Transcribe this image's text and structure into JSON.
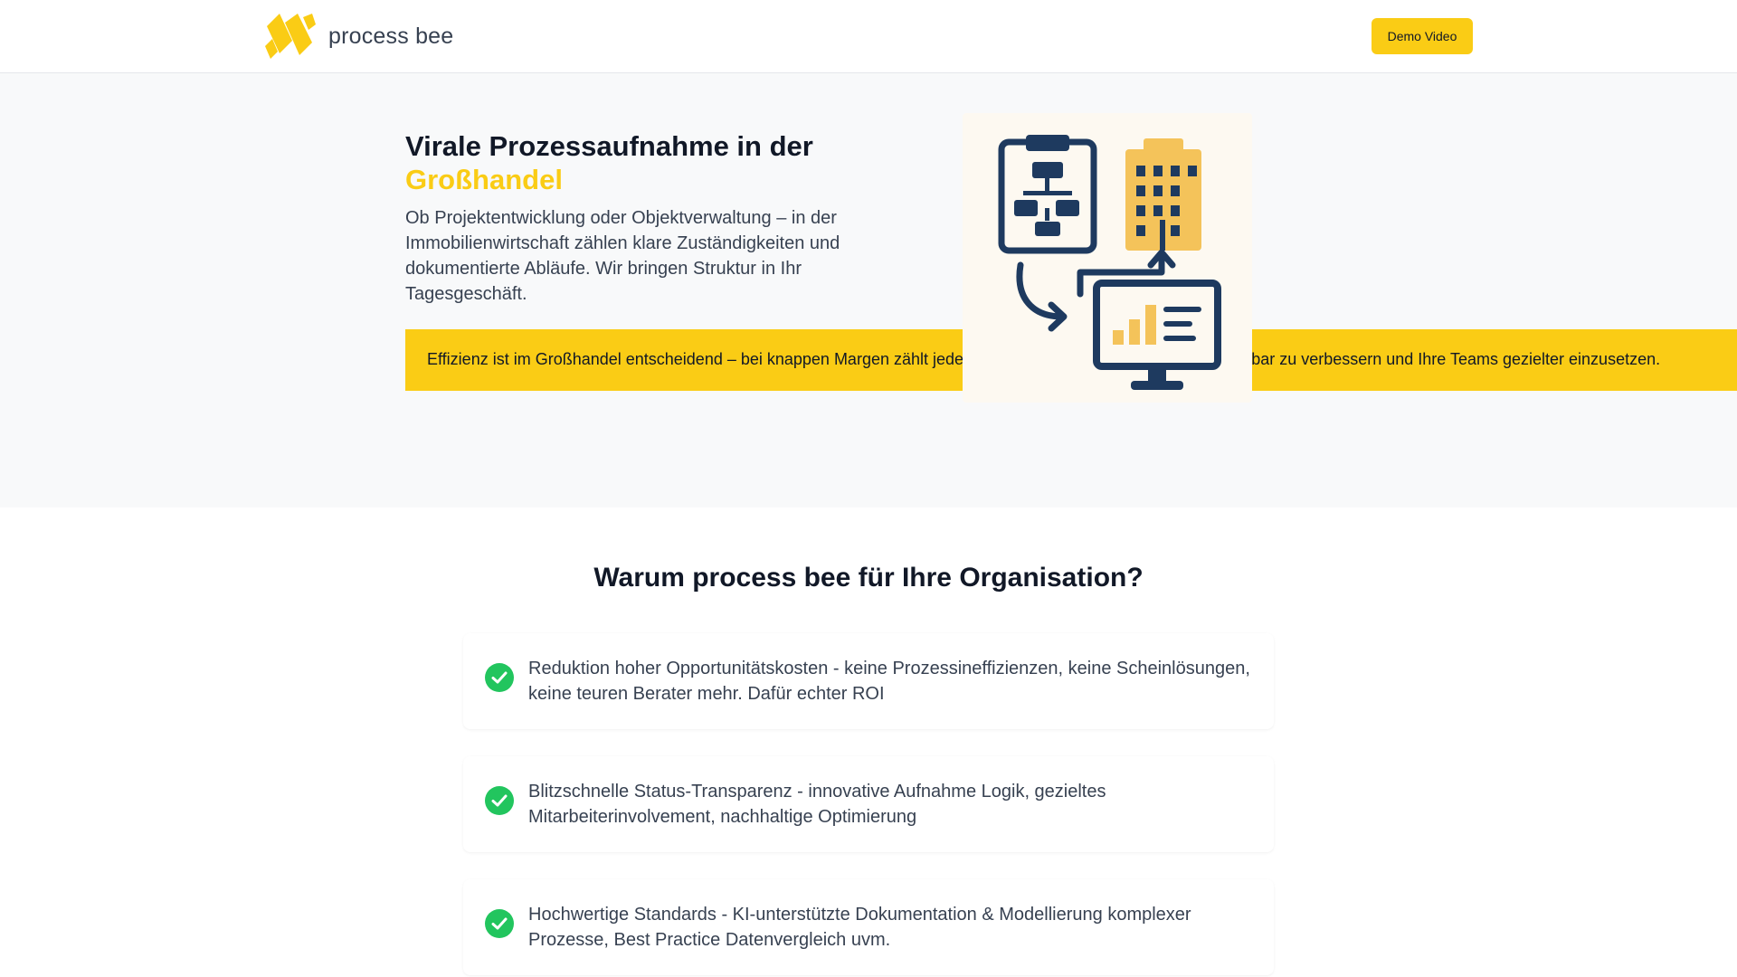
{
  "nav": {
    "logo_text": "process bee",
    "demo_button": "Demo Video"
  },
  "hero": {
    "title_line1": "Virale Prozessaufnahme in der",
    "title_highlight": "Großhandel",
    "subtitle": "Ob Projektentwicklung oder Objektverwaltung – in der Immobilienwirtschaft zählen klare Zuständigkeiten und dokumentierte Abläufe. Wir bringen Struktur in Ihr Tagesgeschäft.",
    "banner_text": "Effizienz ist im Großhandel entscheidend – bei knappen Margen zählt jede Minute. Wir helfen Ihnen, Abläufe messbar zu verbessern und Ihre Teams gezielter einzusetzen."
  },
  "why": {
    "title": "Warum process bee für Ihre Organisation?",
    "features": [
      {
        "text": "Reduktion hoher Opportunitätskosten - keine Prozessineffizienzen, keine Scheinlösungen, keine teuren Berater mehr. Dafür echter ROI"
      },
      {
        "text": "Blitzschnelle Status-Transparenz - innovative Aufnahme Logik, gezieltes Mitarbeiterinvolvement, nachhaltige Optimierung"
      },
      {
        "text": "Hochwertige Standards - KI-unterstützte Dokumentation & Modellierung komplexer Prozesse, Best Practice Datenvergleich uvm."
      }
    ]
  },
  "colors": {
    "accent": "#facc15",
    "navy": "#1e3a5f",
    "check_green": "#22c55e",
    "hero_bg": "#f8f9fa"
  },
  "icons": [
    "logo-icon",
    "flowchart-clipboard-icon",
    "building-icon",
    "monitor-chart-icon",
    "check-circle-icon"
  ]
}
